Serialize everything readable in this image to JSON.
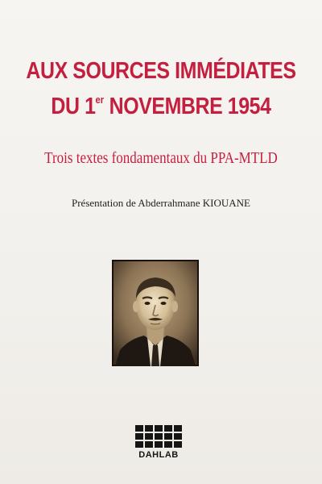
{
  "cover": {
    "title_line1": "AUX SOURCES IMMÉDIATES",
    "title_line2_prefix": "DU 1",
    "title_line2_sup": "er",
    "title_line2_suffix": " NOVEMBRE 1954",
    "subtitle": "Trois textes fondamentaux du PPA-MTLD",
    "presenter": "Présentation de Abderrahmane KIOUANE",
    "photo_icon": "portrait-photo",
    "publisher": {
      "icon": "grid-logo-icon",
      "name": "DAHLAB"
    }
  },
  "colors": {
    "title": "#c41f3f",
    "text": "#222222",
    "background": "#f4f2ee"
  }
}
